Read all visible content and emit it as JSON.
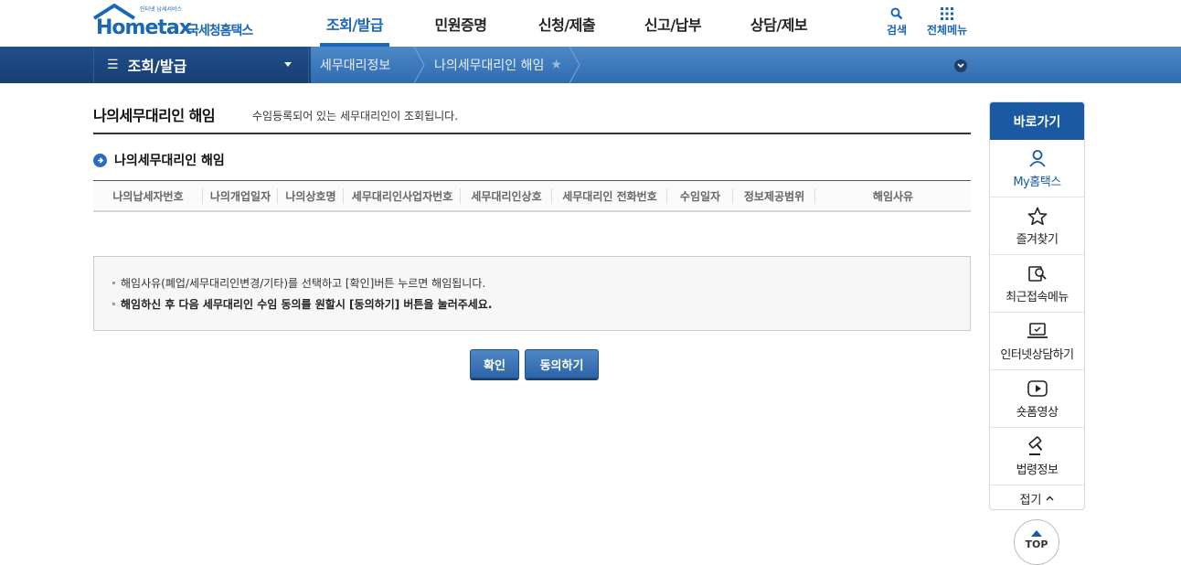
{
  "logo": {
    "brand": "Hometax",
    "small": "인터넷 납세서비스",
    "kr": "국세청홈택스"
  },
  "gnb": {
    "items": [
      {
        "label": "조회/발급"
      },
      {
        "label": "민원증명"
      },
      {
        "label": "신청/제출"
      },
      {
        "label": "신고/납부"
      },
      {
        "label": "상담/제보"
      }
    ],
    "search_label": "검색",
    "allmenu_label": "전체메뉴"
  },
  "nav": {
    "menu_label": "조회/발급",
    "crumb1": "세무대리정보",
    "crumb2": "나의세무대리인 해임"
  },
  "page": {
    "title": "나의세무대리인 해임",
    "description": "수임등록되어 있는 세무대리인이 조회됩니다."
  },
  "section": {
    "title": "나의세무대리인 해임"
  },
  "grid": {
    "columns": [
      "나의납세자번호",
      "나의개업일자",
      "나의상호명",
      "세무대리인사업자번호",
      "세무대리인상호",
      "세무대리인 전화번호",
      "수임일자",
      "정보제공범위",
      "해임사유"
    ]
  },
  "notice": {
    "line1": "해임사유(폐업/세무대리인변경/기타)를 선택하고 [확인]버튼 누르면 해임됩니다.",
    "line2": "해임하신 후 다음 세무대리인 수임 동의를 원할시 [동의하기] 버튼을 눌러주세요."
  },
  "buttons": {
    "ok": "확인",
    "agree": "동의하기"
  },
  "quick": {
    "title": "바로가기",
    "items": [
      {
        "label": "My홈택스",
        "icon": "user-icon"
      },
      {
        "label": "즐겨찾기",
        "icon": "star-icon"
      },
      {
        "label": "최근접속메뉴",
        "icon": "recent-search-icon"
      },
      {
        "label": "인터넷상담하기",
        "icon": "laptop-chat-icon"
      },
      {
        "label": "숏폼영상",
        "icon": "play-icon"
      },
      {
        "label": "법령정보",
        "icon": "gavel-icon"
      }
    ],
    "fold": "접기",
    "top": "TOP"
  },
  "colors": {
    "brand_blue": "#1a66b8",
    "nav_dark": "#1f4f8a",
    "nav_light": "#3a75b8"
  }
}
